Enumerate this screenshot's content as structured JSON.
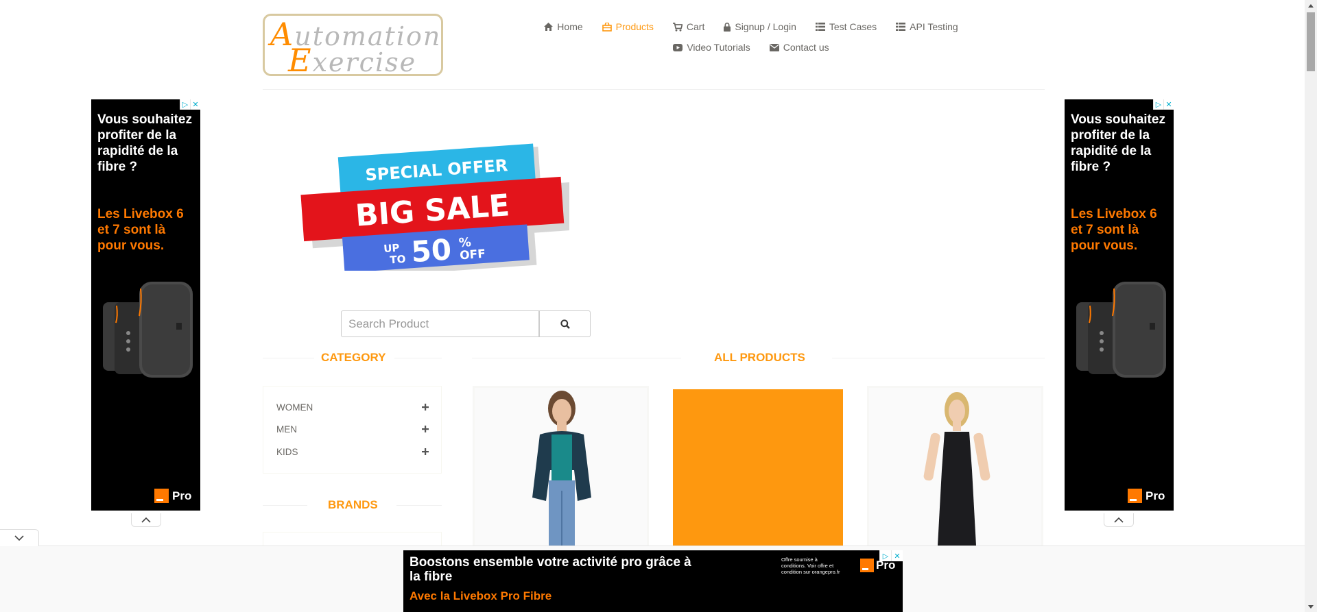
{
  "header": {
    "logo": {
      "line1": "Automation",
      "line2": "Exercise"
    },
    "nav": [
      {
        "label": "Home",
        "icon": "home-icon"
      },
      {
        "label": "Products",
        "icon": "shopping-bag-icon",
        "active": true
      },
      {
        "label": "Cart",
        "icon": "cart-icon"
      },
      {
        "label": "Signup / Login",
        "icon": "lock-icon"
      },
      {
        "label": "Test Cases",
        "icon": "list-icon"
      },
      {
        "label": "API Testing",
        "icon": "list-icon"
      },
      {
        "label": "Video Tutorials",
        "icon": "youtube-icon"
      },
      {
        "label": "Contact us",
        "icon": "envelope-icon"
      }
    ]
  },
  "banner": {
    "special_offer": "SPECIAL OFFER",
    "big_sale": "BIG SALE",
    "up_to": "UP",
    "to": "TO",
    "percent": "50",
    "percent_sign": "%",
    "off": "OFF"
  },
  "search": {
    "placeholder": "Search Product",
    "value": ""
  },
  "sidebar": {
    "category_title": "CATEGORY",
    "categories": [
      {
        "label": "WOMEN"
      },
      {
        "label": "MEN"
      },
      {
        "label": "KIDS"
      }
    ],
    "brands_title": "BRANDS"
  },
  "main": {
    "title": "ALL PRODUCTS"
  },
  "side_ad": {
    "white_text": "Vous souhaitez profiter de la rapidité de la fibre ?",
    "orange_text": "Les Livebox 6 et 7 sont là pour vous.",
    "pro_label": "Pro"
  },
  "bottom_ad": {
    "line1": "Boostons ensemble votre activité pro grâce à la fibre",
    "line2": "Avec la Livebox Pro Fibre",
    "note": "Offre soumise à conditions. Voir offre et condition sur orangepro.fr",
    "pro_label": "Pro"
  },
  "colors": {
    "accent": "#fe980f",
    "text": "#696763",
    "ad_orange": "#ff7900"
  }
}
